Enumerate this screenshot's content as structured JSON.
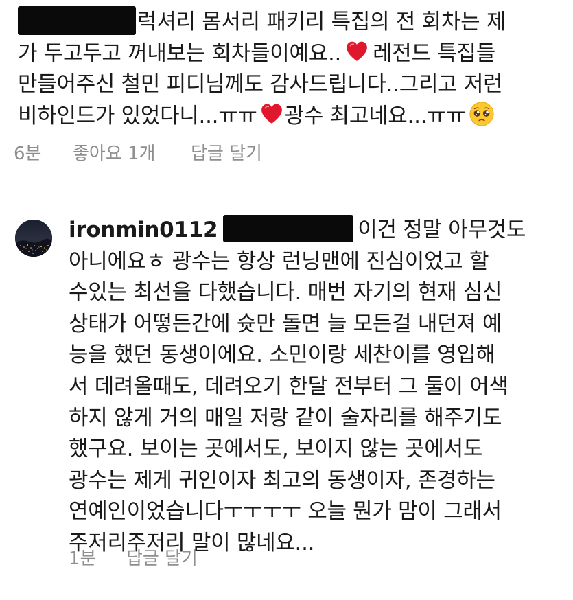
{
  "comment_1": {
    "lines": [
      "럭셔리 몸서리 패키리 특집의 전 회차는 제",
      "가 두고두고 꺼내보는 회차들이예요..",
      "레전드 특집들",
      "만들어주신 철민 피디님께도 감사드립니다..그리고 저런",
      "비하인드가 있었다니...ㅠㅠ",
      "광수 최고네요...ㅠㅠ"
    ],
    "time": "6분",
    "likes": "좋아요 1개",
    "reply": "답글 달기"
  },
  "comment_2": {
    "username": "ironmin0112",
    "first_line_text": "이건 정말 아무것도",
    "lines": [
      "아니에요ㅎ 광수는 항상 런닝맨에 진심이었고 할",
      "수있는 최선을 다했습니다. 매번 자기의 현재 심신",
      "상태가 어떻든간에 슛만 돌면 늘 모든걸 내던져 예",
      "능을 했던 동생이에요. 소민이랑 세찬이를 영입해",
      "서 데려올때도, 데려오기 한달 전부터 그 둘이 어색",
      "하지 않게 거의 매일 저랑 같이 술자리를 해주기도",
      "했구요. 보이는 곳에서도, 보이지 않는 곳에서도",
      "광수는 제게 귀인이자 최고의 동생이자, 존경하는",
      "연예인이었습니다ㅜㅜㅜㅜ 오늘 뭔가 맘이 그래서",
      "주저리주저리 말이 많네요..."
    ],
    "time": "1분",
    "reply": "답글 달기"
  },
  "icons": {
    "heart": "red-heart-emoji",
    "pleading": "pleading-face-emoji",
    "avatar": "night-city-avatar"
  },
  "colors": {
    "text": "#1a1a1a",
    "meta": "#8e8e8e",
    "heart": "#e0182d",
    "redaction": "#0a0a0a"
  }
}
